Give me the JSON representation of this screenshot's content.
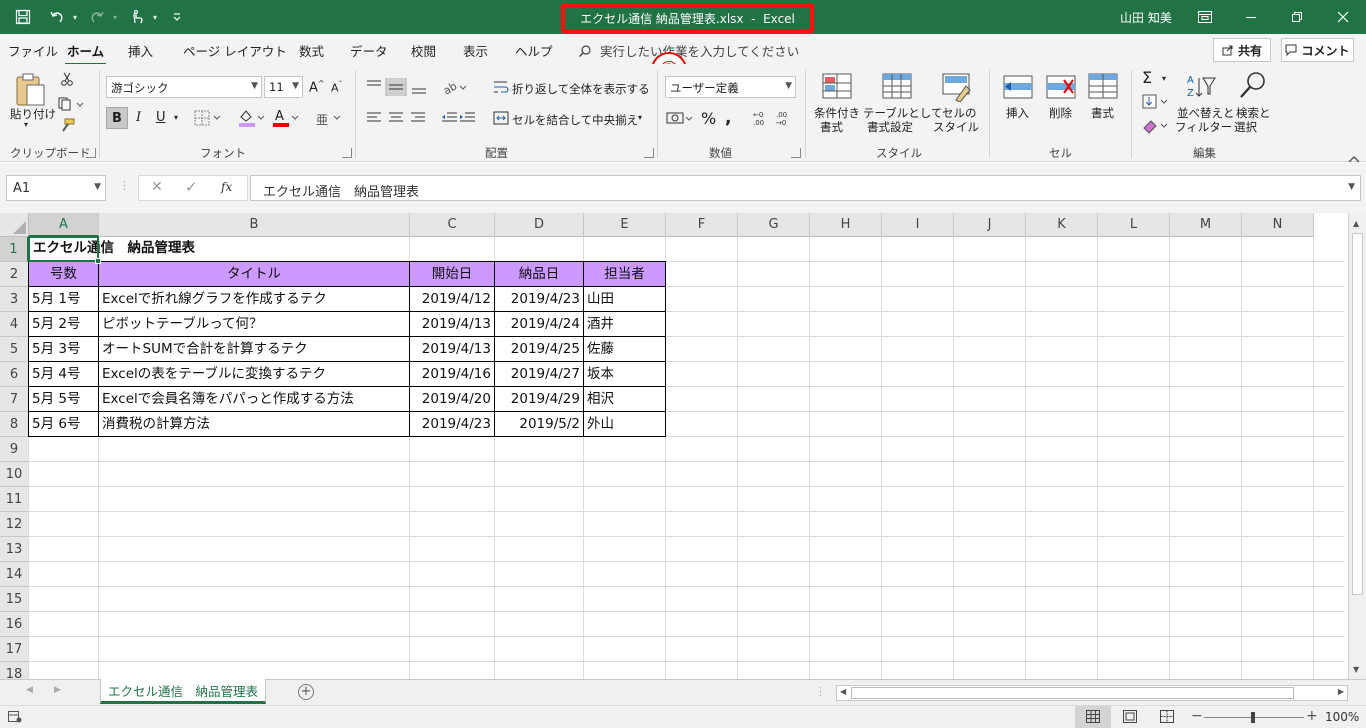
{
  "window": {
    "title": "エクセル通信 納品管理表.xlsx  -  Excel",
    "user": "山田 知美",
    "annotation_number": "①"
  },
  "colors": {
    "brand": "#217346",
    "header_fill": "#cc99ff",
    "highlight": "#ff1010"
  },
  "tabs": [
    "ファイル",
    "ホーム",
    "挿入",
    "ページ レイアウト",
    "数式",
    "データ",
    "校閲",
    "表示",
    "ヘルプ"
  ],
  "active_tab": "ホーム",
  "tell_me": "実行したい作業を入力してください",
  "share_label": "共有",
  "comment_label": "コメント",
  "ribbon": {
    "clipboard": {
      "label": "クリップボード",
      "paste": "貼り付け"
    },
    "font": {
      "label": "フォント",
      "name": "游ゴシック",
      "size": "11",
      "bold": "B",
      "italic": "I",
      "underline": "U"
    },
    "alignment": {
      "label": "配置",
      "wrap": "折り返して全体を表示する",
      "merge": "セルを結合して中央揃え"
    },
    "number": {
      "label": "数値",
      "format": "ユーザー定義"
    },
    "styles": {
      "label": "スタイル",
      "cond1": "条件付き",
      "cond2": "書式",
      "table1": "テーブルとして",
      "table2": "書式設定",
      "cell1": "セルの",
      "cell2": "スタイル"
    },
    "cells": {
      "label": "セル",
      "insert": "挿入",
      "delete": "削除",
      "format": "書式"
    },
    "editing": {
      "label": "編集",
      "sort1": "並べ替えと",
      "sort2": "フィルター",
      "find1": "検索と",
      "find2": "選択"
    }
  },
  "name_box": "A1",
  "formula": "エクセル通信　納品管理表",
  "columns": [
    "A",
    "B",
    "C",
    "D",
    "E",
    "F",
    "G",
    "H",
    "I",
    "J",
    "K",
    "L",
    "M",
    "N"
  ],
  "rows": [
    "1",
    "2",
    "3",
    "4",
    "5",
    "6",
    "7",
    "8",
    "9",
    "10",
    "11",
    "12",
    "13",
    "14",
    "15",
    "16",
    "17",
    "18"
  ],
  "sheet": {
    "title": "エクセル通信　納品管理表",
    "headers": [
      "号数",
      "タイトル",
      "開始日",
      "納品日",
      "担当者"
    ],
    "data": [
      [
        "5月 1号",
        "Excelで折れ線グラフを作成するテク",
        "2019/4/12",
        "2019/4/23",
        "山田"
      ],
      [
        "5月 2号",
        "ピボットテーブルって何？",
        "2019/4/13",
        "2019/4/24",
        "酒井"
      ],
      [
        "5月 3号",
        "オートSUMで合計を計算するテク",
        "2019/4/13",
        "2019/4/25",
        "佐藤"
      ],
      [
        "5月 4号",
        "Excelの表をテーブルに変換するテク",
        "2019/4/16",
        "2019/4/27",
        "坂本"
      ],
      [
        "5月 5号",
        "Excelで会員名簿をパパっと作成する方法",
        "2019/4/20",
        "2019/4/29",
        "相沢"
      ],
      [
        "5月 6号",
        "消費税の計算方法",
        "2019/4/23",
        "2019/5/2",
        "外山"
      ]
    ]
  },
  "sheet_tab": "エクセル通信　納品管理表",
  "zoom": "100%"
}
